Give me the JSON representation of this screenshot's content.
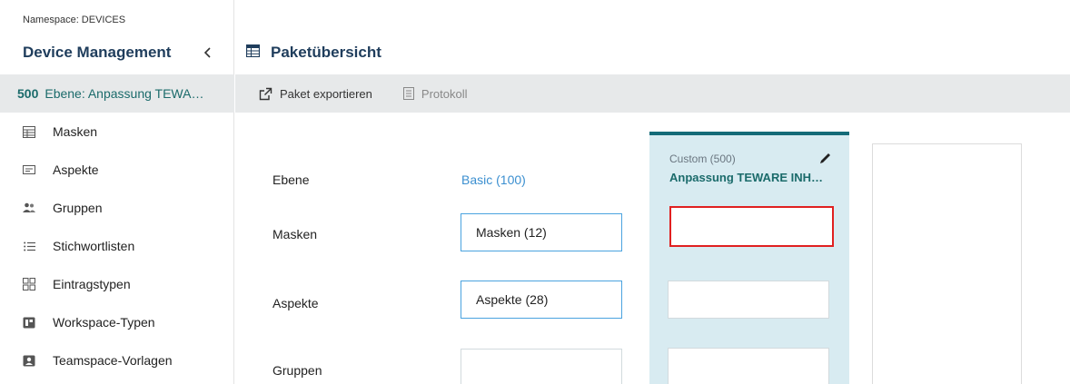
{
  "sidebar": {
    "namespace": "Namespace: DEVICES",
    "title": "Device Management",
    "collapse_icon": "chevron-left-icon",
    "level": {
      "number": "500",
      "name": "Ebene: Anpassung TEWA…"
    },
    "items": [
      {
        "label": "Masken",
        "icon": "table-icon"
      },
      {
        "label": "Aspekte",
        "icon": "card-icon"
      },
      {
        "label": "Gruppen",
        "icon": "people-icon"
      },
      {
        "label": "Stichwortlisten",
        "icon": "list-icon"
      },
      {
        "label": "Eintragstypen",
        "icon": "grid-icon"
      },
      {
        "label": "Workspace-Typen",
        "icon": "workspace-icon"
      },
      {
        "label": "Teamspace-Vorlagen",
        "icon": "template-icon"
      }
    ]
  },
  "main": {
    "title": "Paketübersicht",
    "title_icon": "table-icon",
    "toolbar": {
      "export_label": "Paket exportieren",
      "protocol_label": "Protokoll"
    },
    "rows": {
      "level": "Ebene",
      "masks": "Masken",
      "aspects": "Aspekte",
      "groups": "Gruppen"
    },
    "basic_column": {
      "header": "Basic (100)",
      "masks": "Masken (12)",
      "aspects": "Aspekte (28)",
      "groups": ""
    },
    "custom_column": {
      "label": "Custom (500)",
      "name": "Anpassung TEWARE INH…",
      "accent": "#146b78",
      "background": "#d8ebf1"
    }
  },
  "colors": {
    "title": "#1f3d5c",
    "teal_text": "#1b6b6b",
    "link_blue": "#3b8fd0",
    "toolbar_bg": "#e7e9ea",
    "selection_red": "#e02020"
  }
}
